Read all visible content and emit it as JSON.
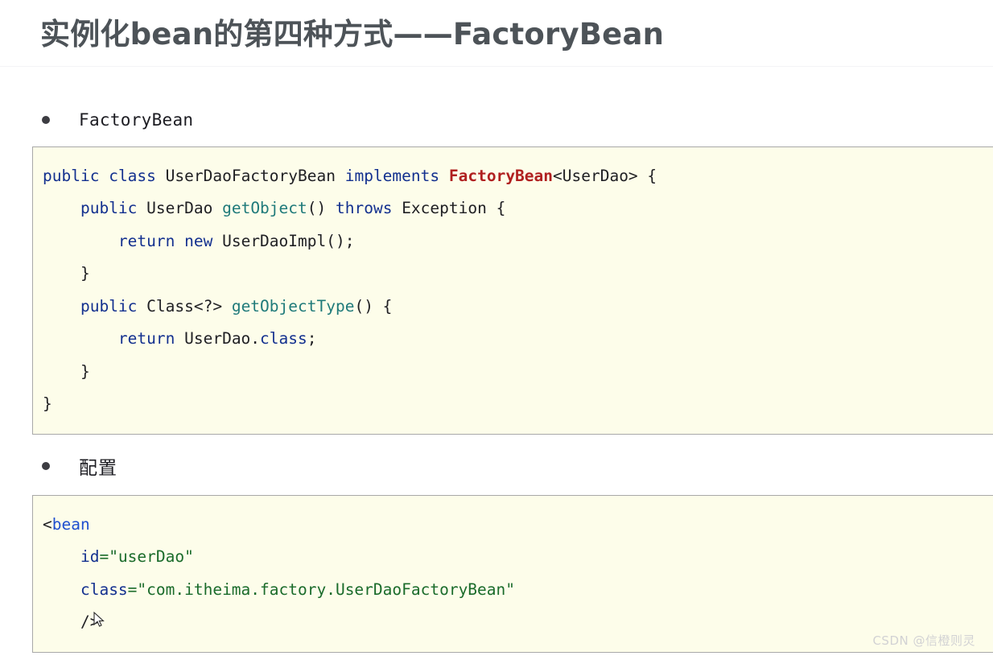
{
  "page": {
    "title": "实例化bean的第四种方式——FactoryBean",
    "watermark": "CSDN @信橙则灵"
  },
  "sections": [
    {
      "bullet_label": "FactoryBean",
      "bullet_icon": "bullet-dot-icon",
      "code_language": "java",
      "code_lines": [
        [
          {
            "t": "public",
            "c": "kw"
          },
          {
            "t": " ",
            "c": "plain"
          },
          {
            "t": "class",
            "c": "kw"
          },
          {
            "t": " UserDaoFactoryBean ",
            "c": "plain"
          },
          {
            "t": "implements",
            "c": "kw"
          },
          {
            "t": " ",
            "c": "plain"
          },
          {
            "t": "FactoryBean",
            "c": "type"
          },
          {
            "t": "<UserDao> {",
            "c": "plain"
          }
        ],
        [
          {
            "t": "    ",
            "c": "plain"
          },
          {
            "t": "public",
            "c": "kw"
          },
          {
            "t": " UserDao ",
            "c": "plain"
          },
          {
            "t": "getObject",
            "c": "fn"
          },
          {
            "t": "() ",
            "c": "plain"
          },
          {
            "t": "throws",
            "c": "kw"
          },
          {
            "t": " Exception {",
            "c": "plain"
          }
        ],
        [
          {
            "t": "        ",
            "c": "plain"
          },
          {
            "t": "return",
            "c": "kw"
          },
          {
            "t": " ",
            "c": "plain"
          },
          {
            "t": "new",
            "c": "kw"
          },
          {
            "t": " UserDaoImpl();",
            "c": "plain"
          }
        ],
        [
          {
            "t": "    }",
            "c": "plain"
          }
        ],
        [
          {
            "t": "    ",
            "c": "plain"
          },
          {
            "t": "public",
            "c": "kw"
          },
          {
            "t": " Class<?> ",
            "c": "plain"
          },
          {
            "t": "getObjectType",
            "c": "fn"
          },
          {
            "t": "() {",
            "c": "plain"
          }
        ],
        [
          {
            "t": "        ",
            "c": "plain"
          },
          {
            "t": "return",
            "c": "kw"
          },
          {
            "t": " UserDao.",
            "c": "plain"
          },
          {
            "t": "class",
            "c": "kw"
          },
          {
            "t": ";",
            "c": "plain"
          }
        ],
        [
          {
            "t": "    }",
            "c": "plain"
          }
        ],
        [
          {
            "t": "}",
            "c": "plain"
          }
        ]
      ]
    },
    {
      "bullet_label": "配置",
      "bullet_icon": "bullet-dot-icon",
      "code_language": "xml",
      "code_lines": [
        [
          {
            "t": "<",
            "c": "plain"
          },
          {
            "t": "bean",
            "c": "tag"
          }
        ],
        [
          {
            "t": "    ",
            "c": "plain"
          },
          {
            "t": "id",
            "c": "attr"
          },
          {
            "t": "=\"userDao\"",
            "c": "val"
          }
        ],
        [
          {
            "t": "    ",
            "c": "plain"
          },
          {
            "t": "class",
            "c": "attr"
          },
          {
            "t": "=\"com.itheima.factory.UserDaoFactoryBean\"",
            "c": "val"
          }
        ],
        [
          {
            "t": "    />",
            "c": "plain"
          }
        ]
      ]
    }
  ],
  "colors": {
    "title": "#4d5358",
    "code_background": "#fdfdea",
    "code_border": "#a8a8a8",
    "keyword": "#13308f",
    "type_highlight": "#b02020",
    "method": "#1f7a7a",
    "xml_tag": "#1f4fcf",
    "xml_value": "#1a6b2a",
    "watermark": "#d2d2d4"
  }
}
